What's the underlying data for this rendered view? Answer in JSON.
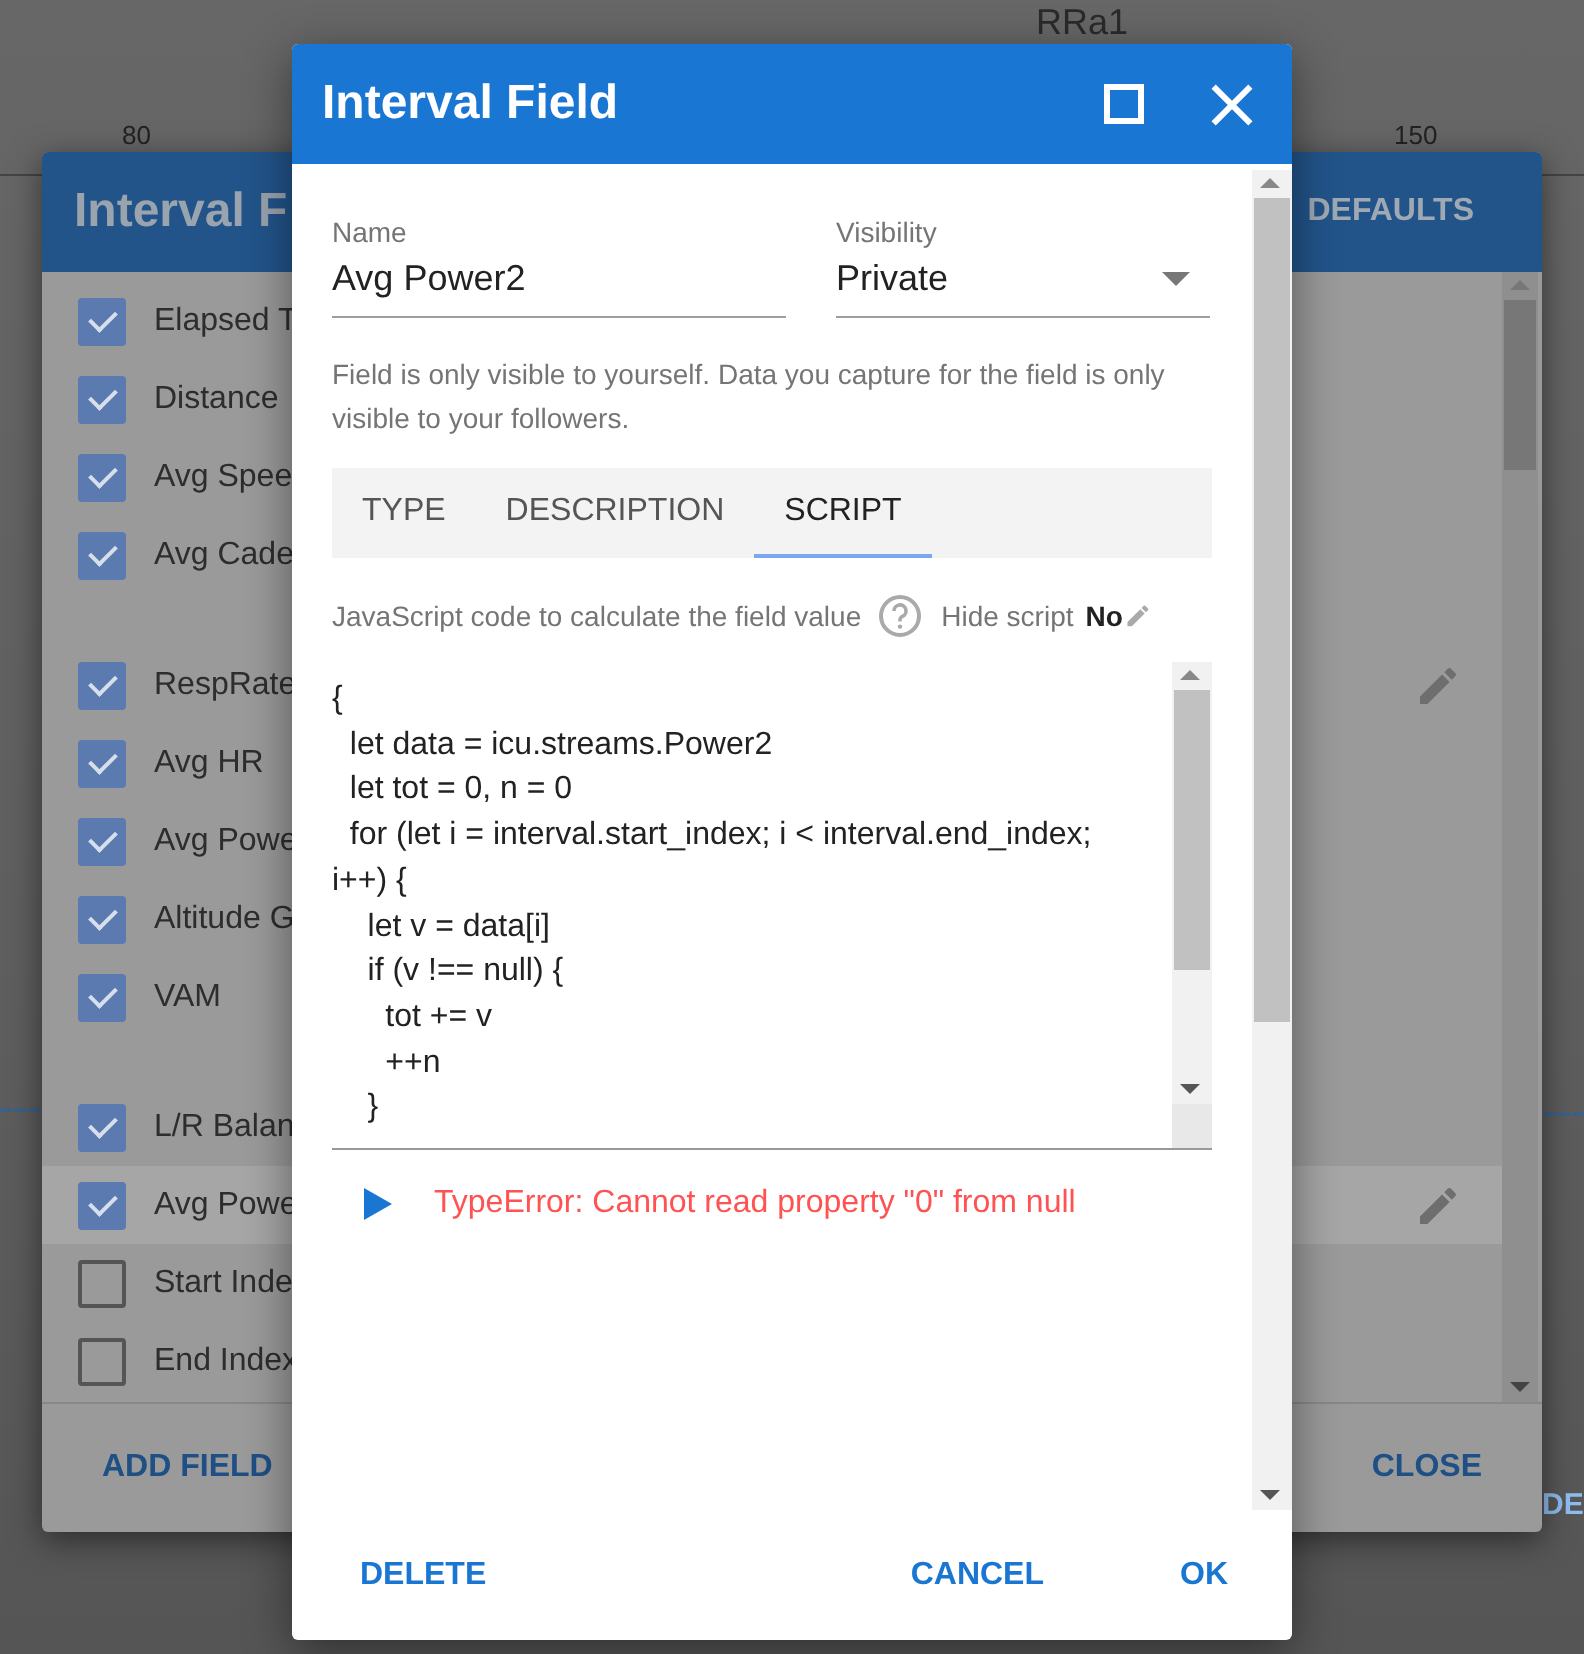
{
  "background_page": {
    "chart_title": "RRa1",
    "axis_labels": [
      "80",
      "150"
    ],
    "side_button": "DE"
  },
  "fields_dialog": {
    "title": "Interval F",
    "defaults_button": "DEFAULTS",
    "groups": [
      {
        "items": [
          {
            "label": "Elapsed T",
            "checked": true,
            "selected": false,
            "edit_icon": false
          },
          {
            "label": "Distance",
            "checked": true,
            "selected": false,
            "edit_icon": false
          },
          {
            "label": "Avg Spee",
            "checked": true,
            "selected": false,
            "edit_icon": false
          },
          {
            "label": "Avg Cade",
            "checked": true,
            "selected": false,
            "edit_icon": false
          }
        ]
      },
      {
        "items": [
          {
            "label": "RespRate",
            "checked": true,
            "selected": false,
            "edit_icon": true
          },
          {
            "label": "Avg HR",
            "checked": true,
            "selected": false,
            "edit_icon": false
          },
          {
            "label": "Avg Powe",
            "checked": true,
            "selected": false,
            "edit_icon": false
          },
          {
            "label": "Altitude G",
            "checked": true,
            "selected": false,
            "edit_icon": false
          },
          {
            "label": "VAM",
            "checked": true,
            "selected": false,
            "edit_icon": false
          }
        ]
      },
      {
        "items": [
          {
            "label": "L/R Balan",
            "checked": true,
            "selected": false,
            "edit_icon": false
          },
          {
            "label": "Avg Powe",
            "checked": true,
            "selected": true,
            "edit_icon": true
          },
          {
            "label": "Start Inde",
            "checked": false,
            "selected": false,
            "edit_icon": false
          },
          {
            "label": "End Index",
            "checked": false,
            "selected": false,
            "edit_icon": false
          }
        ]
      }
    ],
    "add_button": "ADD FIELD",
    "close_button": "CLOSE"
  },
  "field_dialog": {
    "title": "Interval Field",
    "name_field": {
      "label": "Name",
      "value": "Avg Power2"
    },
    "visibility_field": {
      "label": "Visibility",
      "value": "Private"
    },
    "help_text": "Field is only visible to yourself. Data you capture for the field is only visible to your followers.",
    "tabs": [
      {
        "label": "TYPE",
        "selected": false
      },
      {
        "label": "DESCRIPTION",
        "selected": false
      },
      {
        "label": "SCRIPT",
        "selected": true
      }
    ],
    "script_caption": "JavaScript code to calculate the field value",
    "hide_script": {
      "label": "Hide script",
      "value": "No"
    },
    "code": "{\n  let data = icu.streams.Power2\n  let tot = 0, n = 0\n  for (let i = interval.start_index; i < interval.end_index; i++) {\n    let v = data[i]\n    if (v !== null) {\n      tot += v\n      ++n\n    }",
    "error": "TypeError: Cannot read property \"0\" from null",
    "buttons": {
      "delete": "DELETE",
      "cancel": "CANCEL",
      "ok": "OK"
    }
  }
}
